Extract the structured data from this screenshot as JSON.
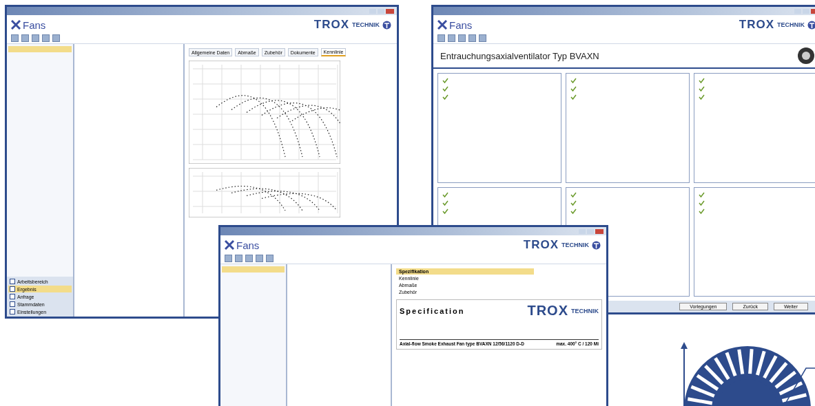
{
  "windows": [
    {
      "kind": "chart",
      "app": "Fans",
      "brand": "TROX",
      "brand_sub": "TECHNIK",
      "tabs": [
        {
          "label": "Allgemeine Daten",
          "selected": false
        },
        {
          "label": "Abmaße",
          "selected": false
        },
        {
          "label": "Zubehör",
          "selected": false
        },
        {
          "label": "Dokumente",
          "selected": false
        },
        {
          "label": "Kennlinie",
          "selected": true
        }
      ],
      "nav": [
        {
          "label": "Arbeitsbereich",
          "selected": false
        },
        {
          "label": "Ergebnis",
          "selected": true
        },
        {
          "label": "Anfrage",
          "selected": false
        },
        {
          "label": "Stammdaten",
          "selected": false
        },
        {
          "label": "Einstellungen",
          "selected": false
        }
      ]
    },
    {
      "kind": "form",
      "app": "Fans",
      "brand": "TROX",
      "brand_sub": "TECHNIK",
      "heading": "Entrauchungsaxialventilator Typ BVAXN",
      "buttons": [
        {
          "label": "Vorlegungen"
        },
        {
          "label": "Zurück"
        },
        {
          "label": "Weiter"
        }
      ]
    },
    {
      "kind": "spec",
      "app": "Fans",
      "brand": "TROX",
      "brand_sub": "TECHNIK",
      "tree": [
        {
          "label": "Spezifikation",
          "selected": true
        },
        {
          "label": "Kennlinie",
          "selected": false
        },
        {
          "label": "Abmaße",
          "selected": false
        },
        {
          "label": "Zubehör",
          "selected": false
        }
      ],
      "doc_title": "Specification",
      "doc_brand": "TROX",
      "doc_brand_sub": "TECHNIK",
      "doc_line": "Axial-flow Smoke Exhaust Fan type BVAXN 12/56/1120 D-D",
      "doc_note": "max. 400° C / 120 Mi"
    }
  ]
}
